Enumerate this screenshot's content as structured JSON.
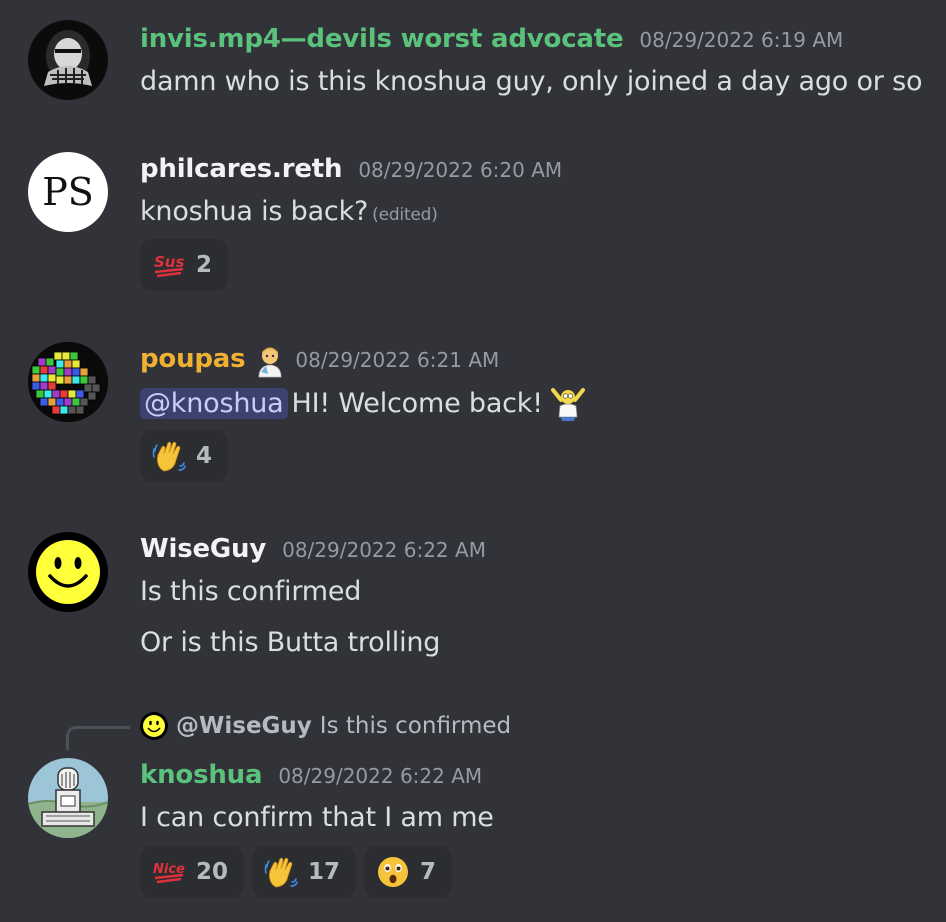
{
  "messages": [
    {
      "username": "invis.mp4—devils worst advocate",
      "name_color": "#5bc27c",
      "timestamp": "08/29/2022 6:19 AM",
      "lines": [
        "damn who is this knoshua guy, only joined a day ago or so"
      ],
      "avatar": "hooded-figure-avatar"
    },
    {
      "username": "philcares.reth",
      "name_color": "#f2f3f5",
      "timestamp": "08/29/2022 6:20 AM",
      "lines": [
        "knoshua is back?"
      ],
      "edited_label": "(edited)",
      "avatar_text": "PS",
      "reactions": [
        {
          "emoji": "sus-emoji",
          "emoji_text": "Sus",
          "count": "2"
        }
      ]
    },
    {
      "username": "poupas",
      "name_color": "#f0b132",
      "badge_icon": "scientist-emoji",
      "timestamp": "08/29/2022 6:21 AM",
      "mention": "@knoshua",
      "lines": [
        "HI! Welcome back!"
      ],
      "inline_emoji": "homer-celebrating-emoji",
      "avatar": "tetris-avatar",
      "reactions": [
        {
          "emoji": "waving-hand-emoji",
          "count": "4"
        }
      ]
    },
    {
      "username": "WiseGuy",
      "name_color": "#f2f3f5",
      "timestamp": "08/29/2022 6:22 AM",
      "lines": [
        "Is this confirmed",
        "Or is this Butta trolling"
      ],
      "avatar": "smiley-face-avatar"
    },
    {
      "reply_to": {
        "name": "@WiseGuy",
        "text": "Is this confirmed",
        "avatar": "smiley-face-avatar"
      },
      "username": "knoshua",
      "name_color": "#5bc27c",
      "timestamp": "08/29/2022 6:22 AM",
      "lines": [
        "I can confirm that I am me"
      ],
      "avatar": "robot-sketch-avatar",
      "reactions": [
        {
          "emoji": "nice-emoji",
          "emoji_text": "Nice",
          "count": "20"
        },
        {
          "emoji": "waving-hand-emoji",
          "count": "17"
        },
        {
          "emoji": "surprised-face-emoji",
          "count": "7"
        }
      ]
    }
  ]
}
